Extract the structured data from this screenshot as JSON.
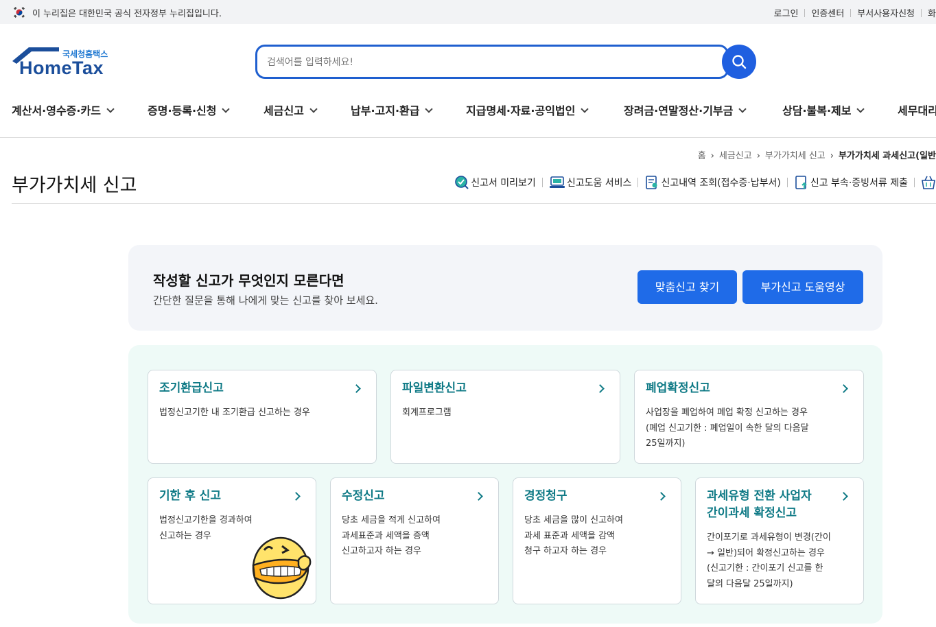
{
  "govbar": {
    "notice": "이 누리집은 대한민국 공식 전자정부 누리집입니다.",
    "links": [
      "로그인",
      "인증센터",
      "부서사용자신청",
      "화"
    ]
  },
  "logo": {
    "sub": "국세청홈택스",
    "main": "HomeTax"
  },
  "search": {
    "placeholder": "검색어를 입력하세요!"
  },
  "gnb": [
    "계산서·영수증·카드",
    "증명·등록·신청",
    "세금신고",
    "납부·고지·환급",
    "지급명세·자료·공익법인",
    "장려금·연말정산·기부금",
    "상담·불복·제보",
    "세무대리"
  ],
  "breadcrumb": [
    "홈",
    "세금신고",
    "부가가치세 신고",
    "부가가치세 과세신고(일반"
  ],
  "page_title": "부가가치세 신고",
  "quick_links": [
    "신고서 미리보기",
    "신고도움 서비스",
    "신고내역 조회(접수증·납부서)",
    "신고 부속·증빙서류 제출"
  ],
  "guide": {
    "title": "작성할 신고가 무엇인지 모른다면",
    "desc": "간단한 질문을 통해 나에게 맞는 신고를 찾아 보세요.",
    "btn1": "맞춤신고 찾기",
    "btn2": "부가신고 도움영상"
  },
  "cards": [
    {
      "title": "조기환급신고",
      "desc": "법정신고기한 내 조기환급 신고하는 경우"
    },
    {
      "title": "파일변환신고",
      "desc": "회계프로그램"
    },
    {
      "title": "폐업확정신고",
      "desc": "사업장을 폐업하여 폐업 확정 신고하는 경우\n(폐업 신고기한 : 폐업일이 속한 달의 다음달\n25일까지)"
    },
    {
      "title": "기한 후 신고",
      "desc": "법정신고기한을 경과하여\n신고하는 경우"
    },
    {
      "title": "수정신고",
      "desc": "당초 세금을 적게 신고하여\n과세표준과 세액을 증액\n신고하고자 하는 경우"
    },
    {
      "title": "경정청구",
      "desc": "당초 세금을 많이 신고하여\n과세 표준과 세액을 감액\n청구 하고자 하는 경우"
    },
    {
      "title": "과세유형 전환 사업자\n간이과세 확정신고",
      "desc": "간이포기로 과세유형이 변경(간이\n→ 일반)되어 확정신고하는 경우\n(신고기한 : 간이포기 신고를 한\n달의 다음달 25일까지)"
    }
  ],
  "colors": {
    "accent": "#1f6be8",
    "teal": "#0f7a86",
    "card_bg": "#eefaf7"
  }
}
